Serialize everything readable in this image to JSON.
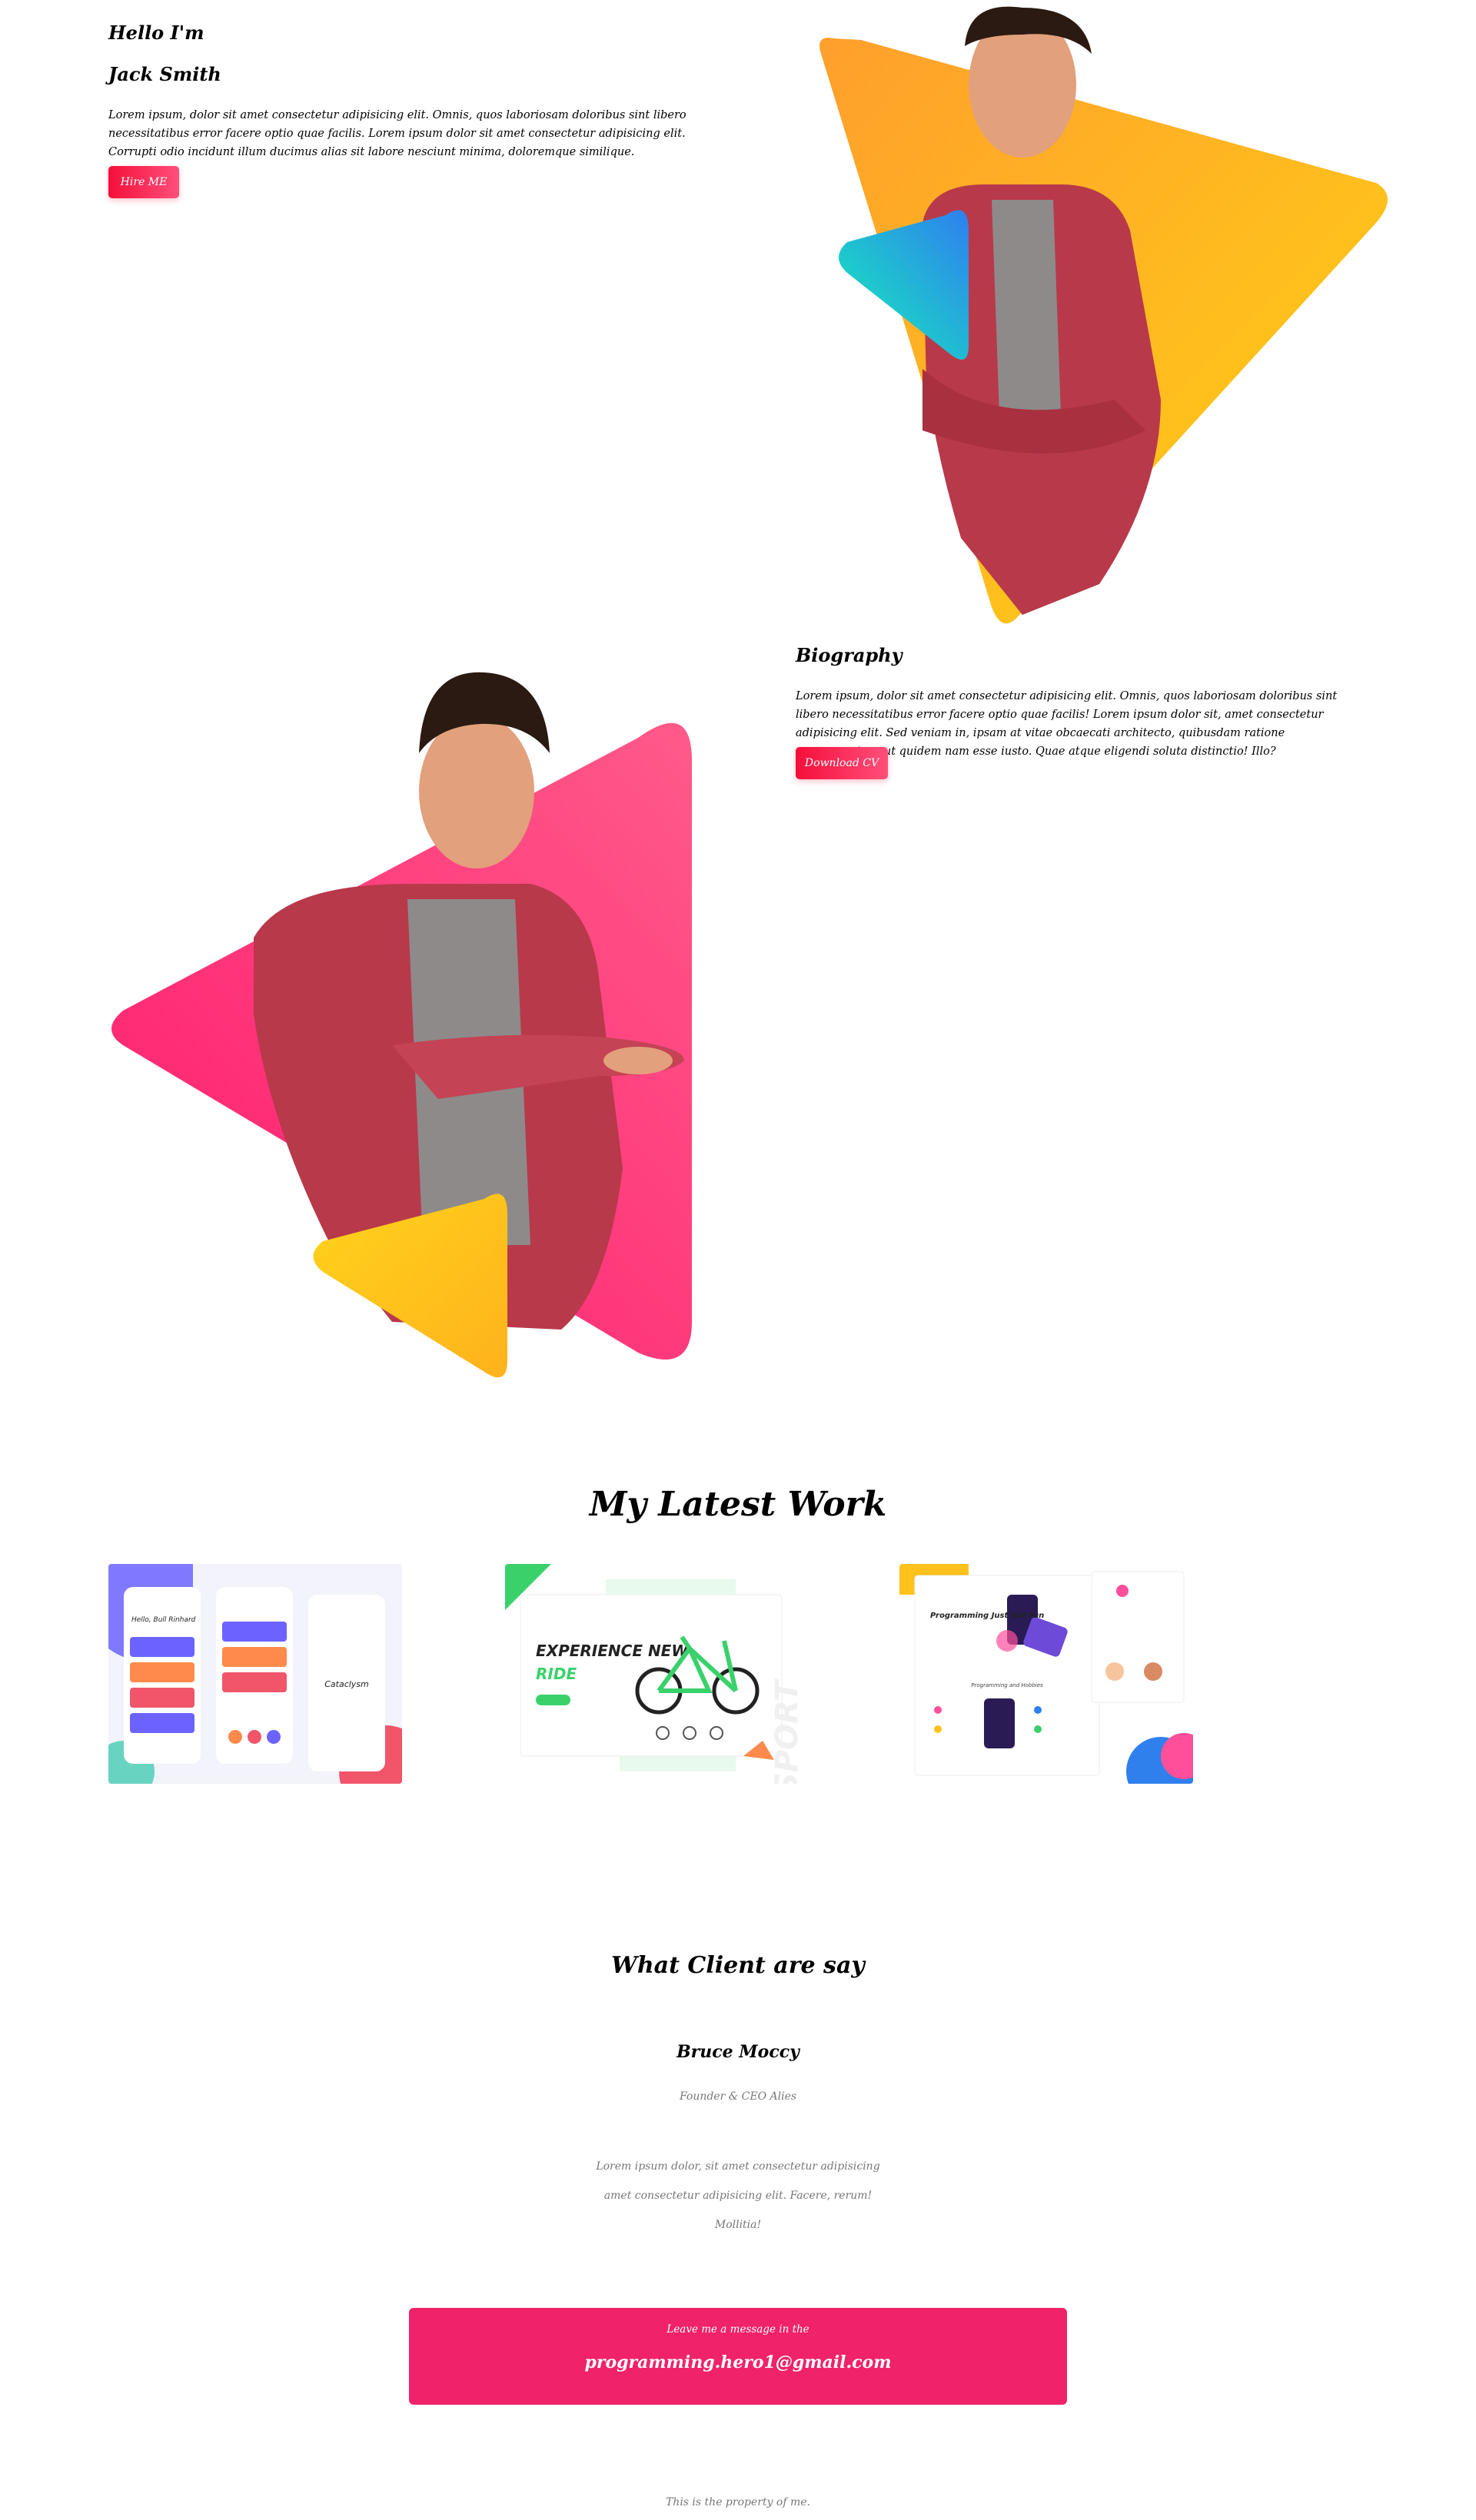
{
  "hero": {
    "greeting": "Hello I'm",
    "name": "Jack Smith",
    "intro": "Lorem ipsum, dolor sit amet consectetur adipisicing elit. Omnis, quos laboriosam doloribus sint libero necessitatibus error facere optio quae facilis. Lorem ipsum dolor sit amet consectetur adipisicing elit. Corrupti odio incidunt illum ducimus alias sit labore nesciunt minima, doloremque similique.",
    "hire_button": "Hire ME"
  },
  "biography": {
    "title": "Biography",
    "text": "Lorem ipsum, dolor sit amet consectetur adipisicing elit. Omnis, quos laboriosam doloribus sint libero necessitatibus error facere optio quae facilis! Lorem ipsum dolor sit, amet consectetur adipisicing elit. Sed veniam in, ipsam at vitae obcaecati architecto, quibusdam ratione consequuntur aut quidem nam esse iusto. Quae atque eligendi soluta distinctio! Illo?",
    "cv_button": "Download CV"
  },
  "work": {
    "title": "My Latest Work",
    "cards": [
      {
        "name": "task-app",
        "heading": "Hello, Bull Rinhard",
        "sub": "Cataclysm"
      },
      {
        "name": "bike-landing",
        "heading": "EXPERIENCE NEW",
        "accent": "RIDE",
        "side_word": "SPORT"
      },
      {
        "name": "programming-site",
        "heading": "Programming Just Got Fun",
        "sub": "Programming and Hobbies"
      }
    ]
  },
  "testimonial": {
    "title": "What Client are say",
    "name": "Bruce Moccy",
    "role": "Founder & CEO Alies",
    "quote_line1": "Lorem ipsum dolor, sit amet consectetur adipisicing",
    "quote_line2": "amet consectetur adipisicing elit. Facere, rerum! Mollitia!"
  },
  "contact": {
    "label": "Leave me a message in the",
    "email": "programming.hero1@gmail.com"
  },
  "footer": {
    "text": "This is the property of me."
  },
  "colors": {
    "accent_red": "#f50f3a",
    "contact_bg": "#f0226a",
    "orange": "#ff9f2c",
    "yellow": "#ffd214",
    "pink": "#ff1a6e",
    "teal": "#14e7c0",
    "blue": "#2f80ed"
  }
}
